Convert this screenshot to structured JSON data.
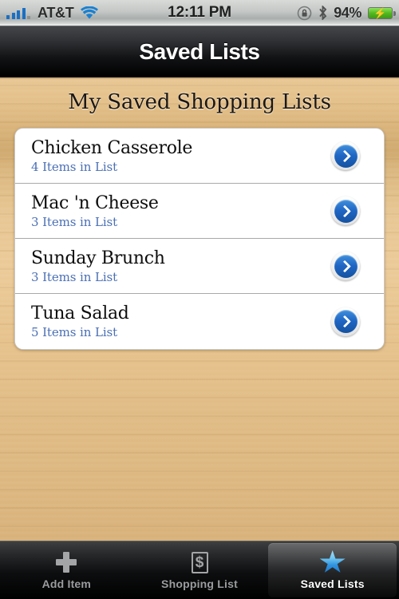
{
  "status_bar": {
    "carrier": "AT&T",
    "time": "12:11 PM",
    "battery_percent": "94%",
    "icons": [
      "signal-bars-icon",
      "wifi-icon",
      "rotation-lock-icon",
      "bluetooth-icon",
      "battery-charging-icon"
    ]
  },
  "nav_bar": {
    "title": "Saved Lists"
  },
  "main": {
    "section_header": "My Saved Shopping Lists",
    "rows": [
      {
        "title": "Chicken Casserole",
        "subtitle": "4 Items in List"
      },
      {
        "title": "Mac 'n Cheese",
        "subtitle": "3 Items in List"
      },
      {
        "title": "Sunday Brunch",
        "subtitle": "3 Items in List"
      },
      {
        "title": "Tuna Salad",
        "subtitle": "5 Items in List"
      }
    ]
  },
  "tab_bar": {
    "tabs": [
      {
        "label": "Add Item",
        "icon": "plus-icon",
        "selected": false
      },
      {
        "label": "Shopping List",
        "icon": "dollar-bill-icon",
        "selected": false
      },
      {
        "label": "Saved Lists",
        "icon": "star-icon",
        "selected": true
      }
    ]
  },
  "colors": {
    "accent_blue": "#1f66c4",
    "subtitle_blue": "#4a6fb5",
    "wood_light": "#e9c794",
    "wood_dark": "#cfa96e",
    "nav_black": "#000000",
    "star_blue": "#2f93e0"
  }
}
